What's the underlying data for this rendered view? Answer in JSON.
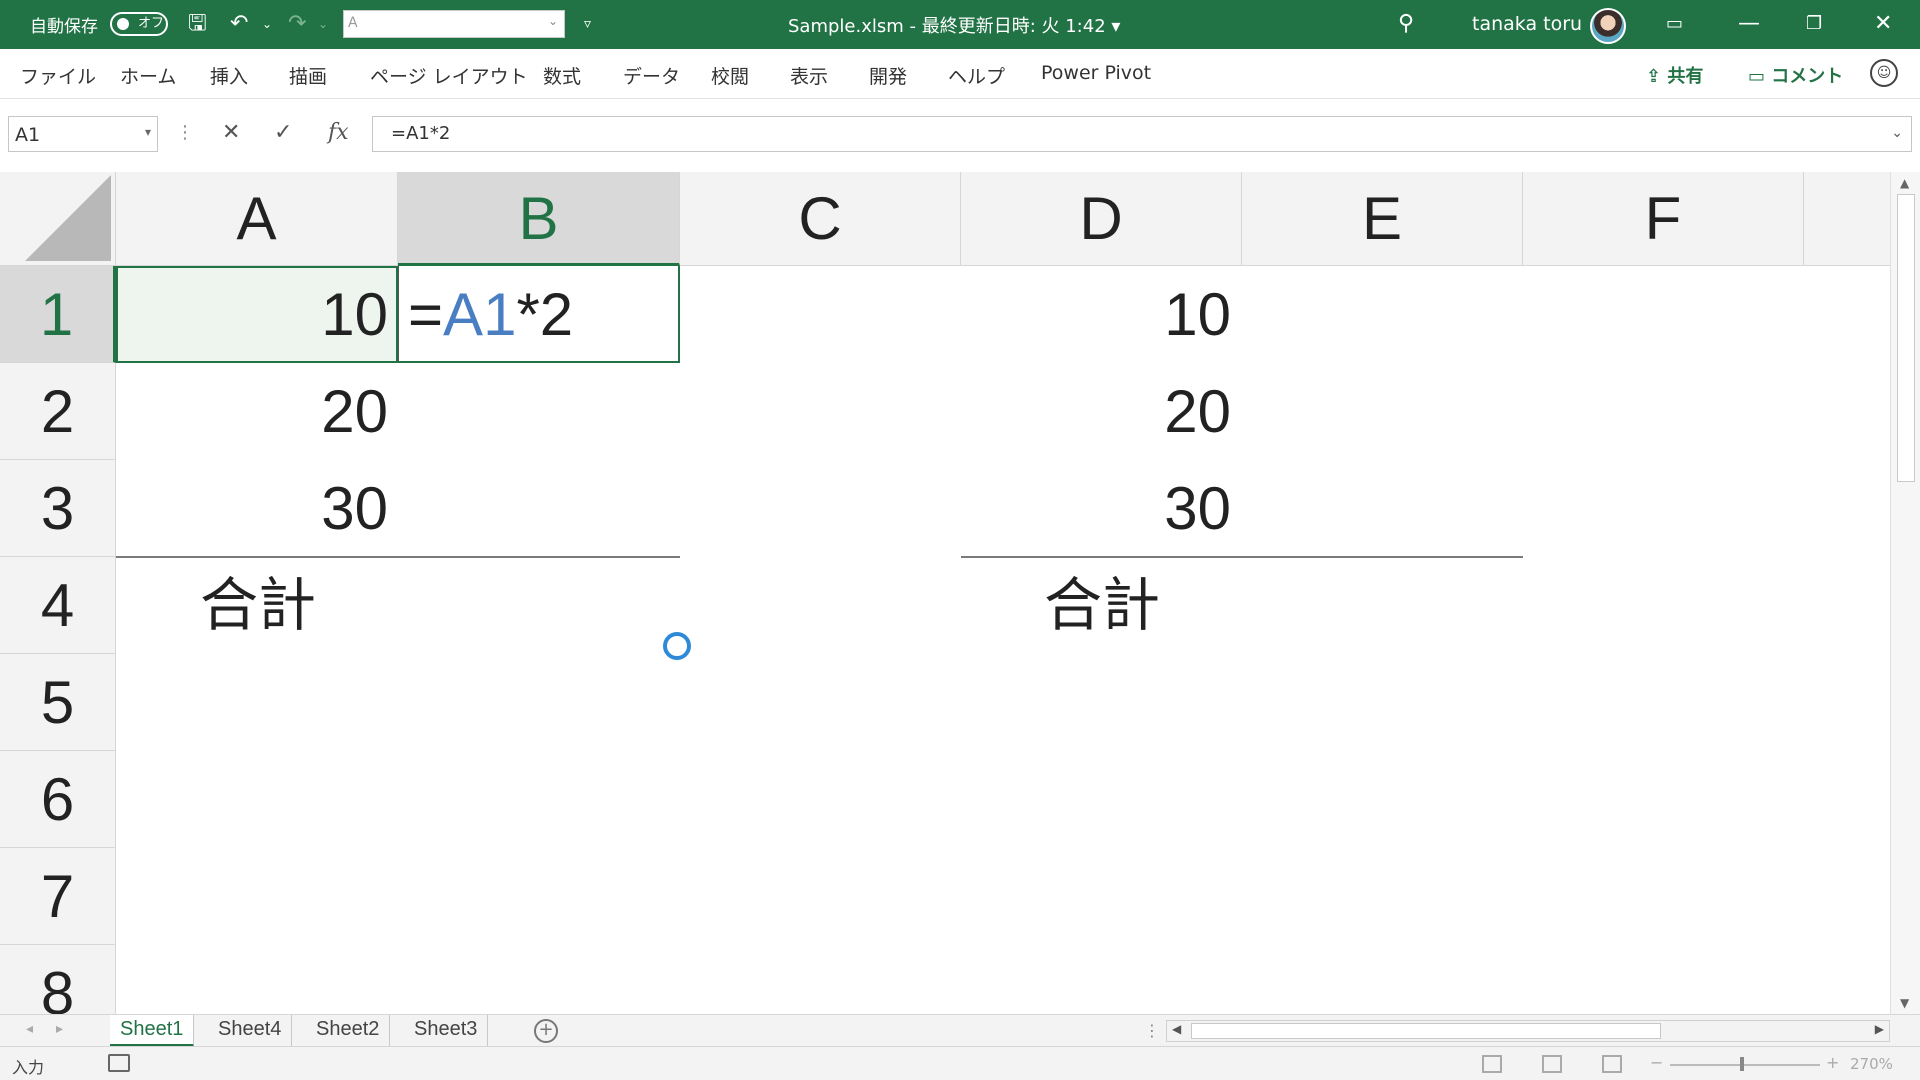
{
  "titlebar": {
    "autosave_label": "自動保存",
    "autosave_state": "オフ",
    "qat_box_value": "A",
    "doc_title": "Sample.xlsm - 最終更新日時: 火 1:42 ▾",
    "user_name": "tanaka toru",
    "icons": [
      "save-icon",
      "undo-icon",
      "redo-icon",
      "customize-qat-icon",
      "search-icon",
      "ribbon-display-icon",
      "minimize-icon",
      "restore-icon",
      "close-icon"
    ]
  },
  "ribbon": {
    "tabs": [
      "ファイル",
      "ホーム",
      "挿入",
      "描画",
      "ページ レイアウト",
      "数式",
      "データ",
      "校閲",
      "表示",
      "開発",
      "ヘルプ",
      "Power Pivot"
    ],
    "share_label": "共有",
    "comment_label": "コメント"
  },
  "formula_bar": {
    "name_box": "A1",
    "cancel_glyph": "✕",
    "enter_glyph": "✓",
    "fx_glyph": "fx",
    "formula": "=A1*2"
  },
  "grid": {
    "columns": [
      "A",
      "B",
      "C",
      "D",
      "E",
      "F"
    ],
    "rows": [
      "1",
      "2",
      "3",
      "4",
      "5",
      "6",
      "7",
      "8"
    ],
    "a_values": [
      "10",
      "20",
      "30"
    ],
    "d_values": [
      "10",
      "20",
      "30"
    ],
    "a4_label": "合計",
    "d4_label": "合計",
    "b1_formula_eq": "=",
    "b1_formula_ref": "A1",
    "b1_formula_rest": "*2"
  },
  "sheets": {
    "tabs": [
      "Sheet1",
      "Sheet4",
      "Sheet2",
      "Sheet3"
    ],
    "active": "Sheet1"
  },
  "statusbar": {
    "mode": "入力",
    "zoom": "270%"
  },
  "colors": {
    "accent": "#217346",
    "ref_blue": "#4a7ec2"
  }
}
